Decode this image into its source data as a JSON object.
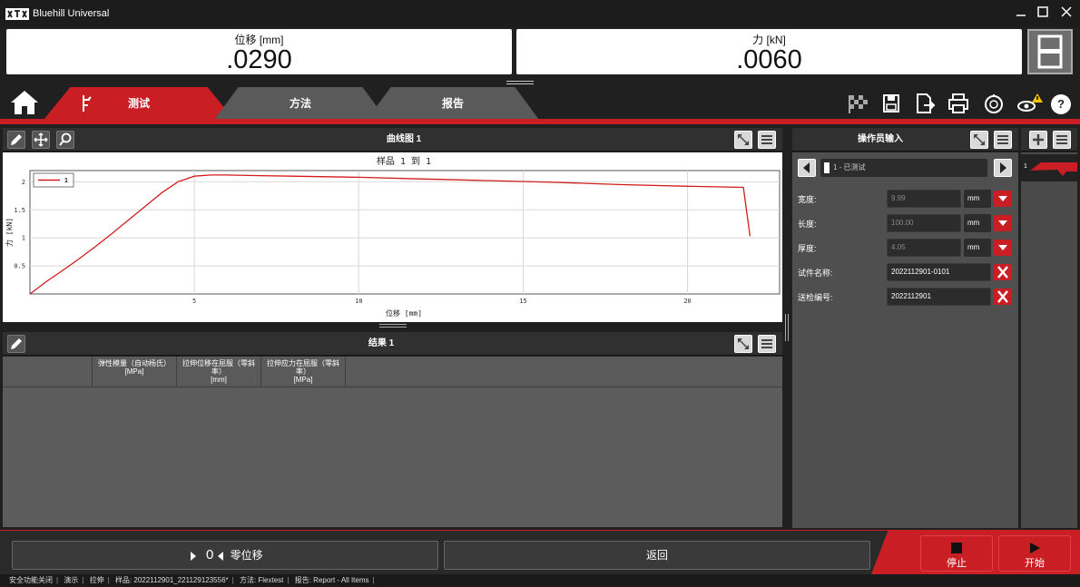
{
  "app": {
    "title": "Bluehill Universal",
    "logo": "ITW"
  },
  "readouts": [
    {
      "label": "位移 [mm]",
      "value": ".0290"
    },
    {
      "label": "力 [kN]",
      "value": ".0060"
    }
  ],
  "tabs": [
    {
      "label": "测试",
      "active": true
    },
    {
      "label": "方法",
      "active": false
    },
    {
      "label": "报告",
      "active": false
    }
  ],
  "toolbar_icons": [
    "checkered-flag-icon",
    "save-icon",
    "export-icon",
    "print-icon",
    "timer-icon",
    "alert-icon",
    "help-icon"
  ],
  "help_label": "?",
  "chart_panel": {
    "title": "曲线图 1"
  },
  "chart_data": {
    "type": "line",
    "title": "样品 1 到 1",
    "xlabel": "位移 [mm]",
    "ylabel": "力 [kN]",
    "xlim": [
      0,
      22.8
    ],
    "ylim": [
      0,
      2.2
    ],
    "xticks": [
      5,
      10,
      15,
      20
    ],
    "yticks": [
      0.5,
      1,
      1.5,
      2
    ],
    "grid": true,
    "legend": "top-left",
    "series": [
      {
        "name": "1",
        "color": "#d11c1c",
        "x": [
          0,
          0.5,
          1,
          1.5,
          2,
          2.5,
          3,
          3.5,
          4,
          4.5,
          5,
          5.5,
          6,
          7,
          8,
          10,
          12,
          14,
          16,
          18,
          20,
          21.7,
          21.9
        ],
        "y": [
          0,
          0.22,
          0.42,
          0.63,
          0.85,
          1.08,
          1.32,
          1.56,
          1.8,
          2.0,
          2.1,
          2.12,
          2.12,
          2.11,
          2.1,
          2.08,
          2.05,
          2.02,
          1.99,
          1.95,
          1.92,
          1.9,
          1.03
        ]
      }
    ]
  },
  "results_panel": {
    "title": "结果 1",
    "columns": [
      {
        "line1": "弹性模量（自动杨氏）",
        "line2": "",
        "unit": "[MPa]"
      },
      {
        "line1": "拉伸位移在屈服（零斜",
        "line2": "率）",
        "unit": "[mm]"
      },
      {
        "line1": "拉伸应力在屈服（零斜",
        "line2": "率）",
        "unit": "[MPa]"
      }
    ]
  },
  "operator_panel": {
    "title": "操作员输入",
    "specimen": "1 - 已测试",
    "specimen_index": "1",
    "fields": [
      {
        "label": "宽度:",
        "value": "9.99",
        "unit": "mm",
        "type": "unit"
      },
      {
        "label": "长度:",
        "value": "100.00",
        "unit": "mm",
        "type": "unit"
      },
      {
        "label": "厚度:",
        "value": "4.05",
        "unit": "mm",
        "type": "unit"
      },
      {
        "label": "试件名称:",
        "value": "2022112901-0101",
        "unit": "",
        "type": "clear"
      },
      {
        "label": "送检编号:",
        "value": "2022112901",
        "unit": "",
        "type": "clear"
      }
    ]
  },
  "side_panel": {
    "item_index": "1"
  },
  "bottom": {
    "zero_value": "0",
    "zero_label": "零位移",
    "return_label": "返回",
    "stop_label": "停止",
    "start_label": "开始"
  },
  "status": {
    "safety": "安全功能关闭",
    "mode": "演示",
    "type": "拉伸",
    "sample": "样品: 2022112901_221129123556*",
    "method": "方法: Flextest",
    "report": "报告: Report - All Items"
  }
}
